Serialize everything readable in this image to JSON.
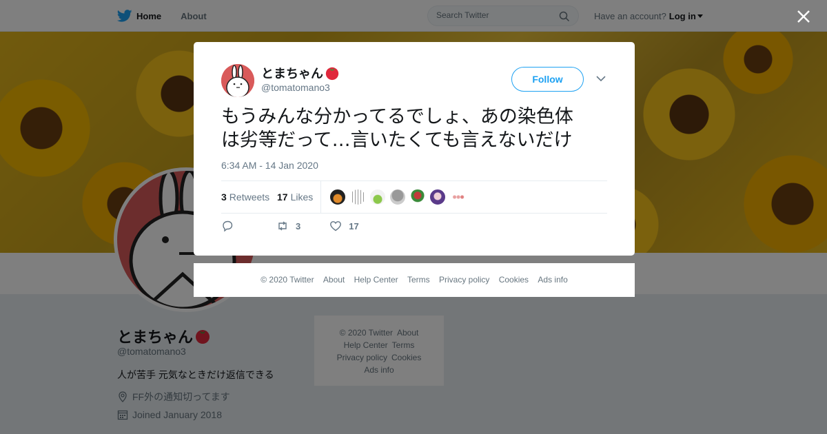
{
  "nav": {
    "home": "Home",
    "about": "About",
    "search_placeholder": "Search Twitter",
    "have_account": "Have an account?",
    "login": "Log in"
  },
  "profile": {
    "name": "とまちゃん",
    "handle": "@tomatomano3",
    "bio": "人が苦手 元気なときだけ返信できる",
    "location": "FF外の通知切ってます",
    "joined": "Joined January 2018"
  },
  "side_footer": {
    "copyright": "© 2020 Twitter",
    "about": "About",
    "help": "Help Center",
    "terms": "Terms",
    "privacy": "Privacy policy",
    "cookies": "Cookies",
    "ads": "Ads info"
  },
  "tweet": {
    "name": "とまちゃん",
    "handle": "@tomatomano3",
    "follow_label": "Follow",
    "text_line1": "もうみんな分かってるでしょ、あの染色体",
    "text_line2": "は劣等だって…言いたくても言えないだけ",
    "timestamp": "6:34 AM - 14 Jan 2020",
    "retweets_count": "3",
    "retweets_label": "Retweets",
    "likes_count": "17",
    "likes_label": "Likes",
    "action_retweet_count": "3",
    "action_like_count": "17"
  },
  "modal_footer": {
    "copyright": "© 2020 Twitter",
    "about": "About",
    "help": "Help Center",
    "terms": "Terms",
    "privacy": "Privacy policy",
    "cookies": "Cookies",
    "ads": "Ads info"
  },
  "colors": {
    "accent": "#1da1f2",
    "tomato": "#e0283c"
  }
}
